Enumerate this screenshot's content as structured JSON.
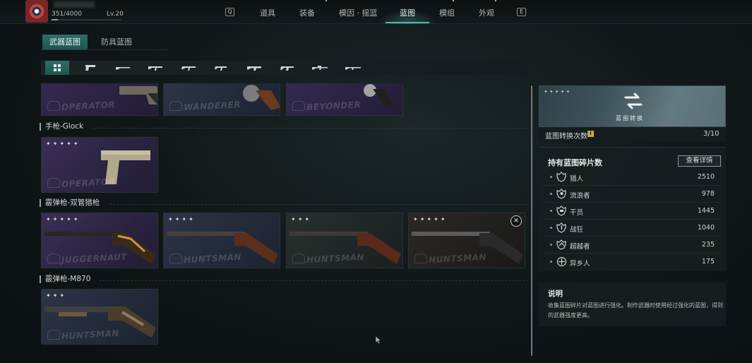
{
  "player": {
    "avatar_icon": "eye-emblem-avatar",
    "xp": "351/4000",
    "level": "Lv.20",
    "xp_progress": 0.0878
  },
  "top_nav": {
    "prev_key": "Q",
    "next_key": "E",
    "tabs": [
      "道具",
      "装备",
      "模因 · 摇篮",
      "蓝图",
      "模组",
      "外观"
    ],
    "active_tab": "蓝图"
  },
  "sub_tabs": {
    "items": [
      "武器蓝图",
      "防具蓝图"
    ],
    "active": "武器蓝图"
  },
  "filters": {
    "items": [
      "all-grid-icon",
      "pistol-icon",
      "shotgun-icon",
      "rifle-icon",
      "assault-rifle-icon",
      "smg-icon",
      "lmg-icon",
      "carbine-icon",
      "sniper-icon",
      "marksman-icon"
    ],
    "active": "all-grid-icon"
  },
  "blueprint_sections": [
    {
      "title": "",
      "cards": [
        {
          "skin": "OPERATOR",
          "stars": 0,
          "tint": "violet"
        },
        {
          "skin": "WANDERER",
          "stars": 0,
          "tint": "blue"
        },
        {
          "skin": "BEYONDER",
          "stars": 0,
          "tint": "violet"
        }
      ]
    },
    {
      "title": "手枪-Glock",
      "cards": [
        {
          "skin": "OPERATOR",
          "stars": 5,
          "tint": "purple"
        }
      ]
    },
    {
      "title": "霰弹枪-双管猎枪",
      "cards": [
        {
          "skin": "JUGGERNAUT",
          "stars": 5,
          "tint": "purple"
        },
        {
          "skin": "HUNTSMAN",
          "stars": 4,
          "tint": "blue"
        },
        {
          "skin": "HUNTSMAN",
          "stars": 3,
          "tint": "green"
        },
        {
          "skin": "HUNTSMAN",
          "stars": 5,
          "tint": "dark"
        }
      ]
    },
    {
      "title": "霰弹枪-M870",
      "cards": [
        {
          "skin": "HUNTSMAN",
          "stars": 3,
          "tint": "blue"
        }
      ]
    }
  ],
  "right_panel": {
    "banner_label": "蓝图转换",
    "banner_icon": "swap-arrows-icon",
    "conversion_label": "蓝图转换次数",
    "conversion_count": "3/10",
    "fragments_title": "持有蓝图碎片数",
    "details_button": "查看详情",
    "fragments": [
      {
        "name": "猎人",
        "count": "2510",
        "icon": "hunter-emblem-icon"
      },
      {
        "name": "流浪者",
        "count": "978",
        "icon": "wanderer-emblem-icon"
      },
      {
        "name": "干员",
        "count": "1445",
        "icon": "operator-emblem-icon"
      },
      {
        "name": "战狂",
        "count": "1040",
        "icon": "juggernaut-emblem-icon"
      },
      {
        "name": "超越者",
        "count": "235",
        "icon": "beyonder-emblem-icon"
      },
      {
        "name": "异乡人",
        "count": "175",
        "icon": "outlander-emblem-icon"
      }
    ],
    "description_title": "说明",
    "description_text": "收集蓝图碎片对蓝图进行强化。制作武器时使用经过强化的蓝图，得到的武器强度更高。"
  }
}
